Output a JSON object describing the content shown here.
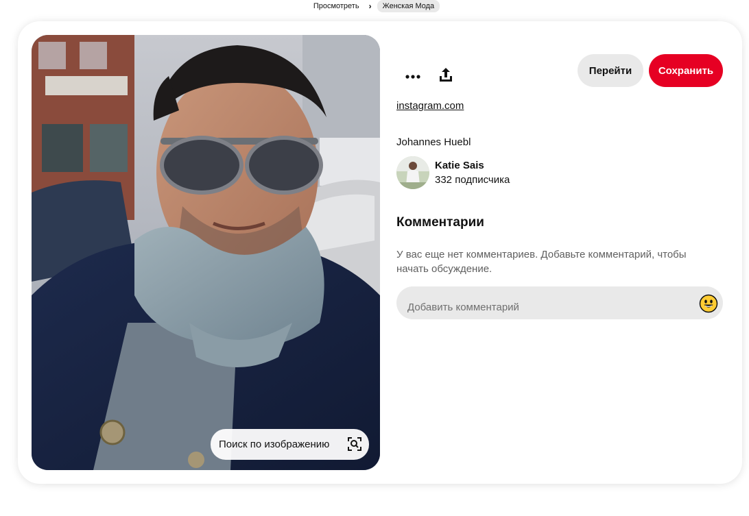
{
  "breadcrumb": {
    "items": [
      "Просмотреть",
      "Женская Мода"
    ]
  },
  "image_search": {
    "label": "Поиск по изображению"
  },
  "actions": {
    "more_icon": "more-dots-icon",
    "share_icon": "share-upload-icon",
    "go_label": "Перейти",
    "save_label": "Сохранить"
  },
  "pin": {
    "source": "instagram.com",
    "title": "Johannes Huebl"
  },
  "author": {
    "name": "Katie Sais",
    "followers": "332 подписчика"
  },
  "comments": {
    "title": "Комментарии",
    "empty_text": "У вас еще нет комментариев. Добавьте комментарий, чтобы начать обсуждение.",
    "placeholder": "Добавить комментарий",
    "emoji_icon": "smiley-emoji-icon"
  },
  "colors": {
    "brand_red": "#e60023",
    "button_gray": "#e9e9e9"
  }
}
